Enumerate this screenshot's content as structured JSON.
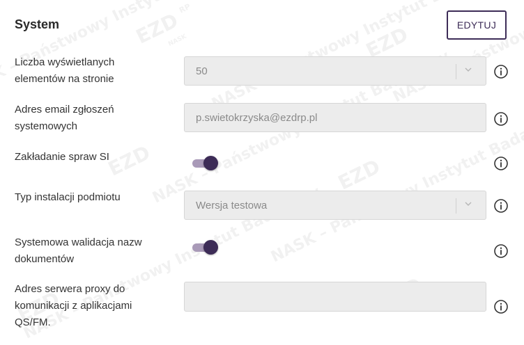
{
  "section": {
    "title": "System",
    "edit_label": "EDYTUJ"
  },
  "watermark": {
    "text": "NASK – Państwowy Instytut Badawczy",
    "logo": "EZD",
    "logo_sub": "RP",
    "logo_small": "NASK"
  },
  "settings": [
    {
      "label": "Liczba wyświetlanych elementów na stronie",
      "type": "select",
      "value": "50",
      "info_icon": "info-icon"
    },
    {
      "label": "Adres email zgłoszeń systemowych",
      "type": "text",
      "value": "p.swietokrzyska@ezdrp.pl",
      "info_icon": "info-icon"
    },
    {
      "label": "Zakładanie spraw SI",
      "type": "toggle",
      "value": "on",
      "info_icon": "info-icon"
    },
    {
      "label": "Typ instalacji podmiotu",
      "type": "select",
      "value": "Wersja testowa",
      "info_icon": "info-icon"
    },
    {
      "label": "Systemowa walidacja nazw dokumentów",
      "type": "toggle",
      "value": "on",
      "info_icon": "info-icon"
    },
    {
      "label": "Adres serwera proxy do komunikacji z aplikacjami QS/FM.",
      "type": "text",
      "value": "",
      "info_icon": "info-icon"
    }
  ],
  "colors": {
    "accent": "#3d2c57",
    "toggle_track": "#a99ab8",
    "field_bg": "#ececec"
  }
}
